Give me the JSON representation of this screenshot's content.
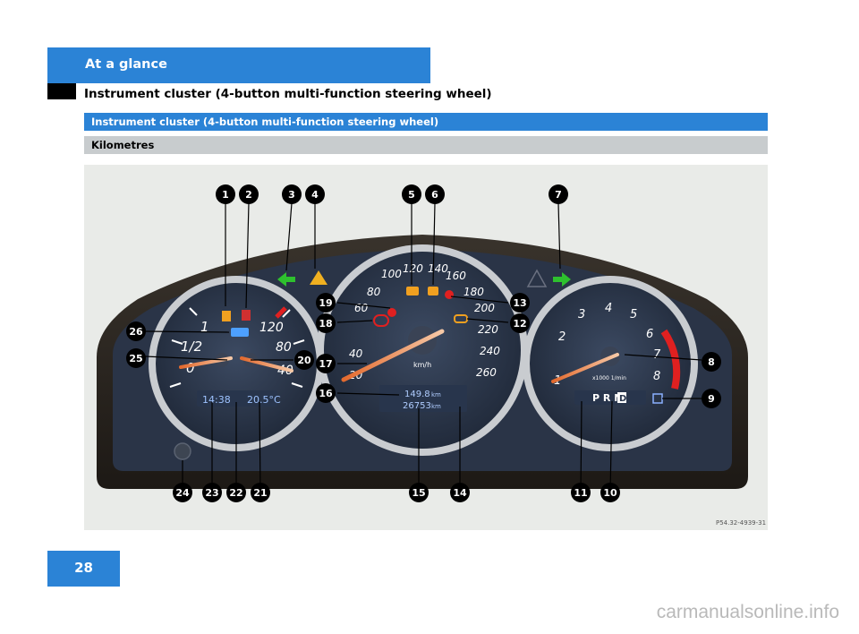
{
  "header": {
    "section_title": "At a glance",
    "page_heading": "Instrument cluster (4-button multi-function steering wheel)"
  },
  "bars": {
    "blue_label": "Instrument cluster (4-button multi-function steering wheel)",
    "gray_label": "Kilometres"
  },
  "figure": {
    "callouts": [
      "1",
      "2",
      "3",
      "4",
      "5",
      "6",
      "7",
      "8",
      "9",
      "10",
      "11",
      "12",
      "13",
      "14",
      "15",
      "16",
      "17",
      "18",
      "19",
      "20",
      "21",
      "22",
      "23",
      "24",
      "25",
      "26"
    ],
    "image_code": "P54.32-4939-31",
    "speedo": {
      "ticks": [
        "20",
        "40",
        "60",
        "80",
        "100",
        "120",
        "140",
        "160",
        "180",
        "200",
        "220",
        "240",
        "260"
      ],
      "unit": "km/h",
      "trip": "149.8",
      "total": "26753",
      "odo_unit": "km"
    },
    "fuel_temp": {
      "labels": [
        "0",
        "1/2",
        "1",
        "120",
        "80",
        "40"
      ],
      "clock": "14:38",
      "outside_temp": "20.5°C"
    },
    "tacho": {
      "ticks": [
        "1",
        "2",
        "3",
        "4",
        "5",
        "6",
        "7",
        "8"
      ],
      "unit": "x1000 1/min",
      "gear": "P R N",
      "gear_selected": "D"
    }
  },
  "footer": {
    "page_number": "28",
    "watermark": "carmanualsonline.info"
  }
}
